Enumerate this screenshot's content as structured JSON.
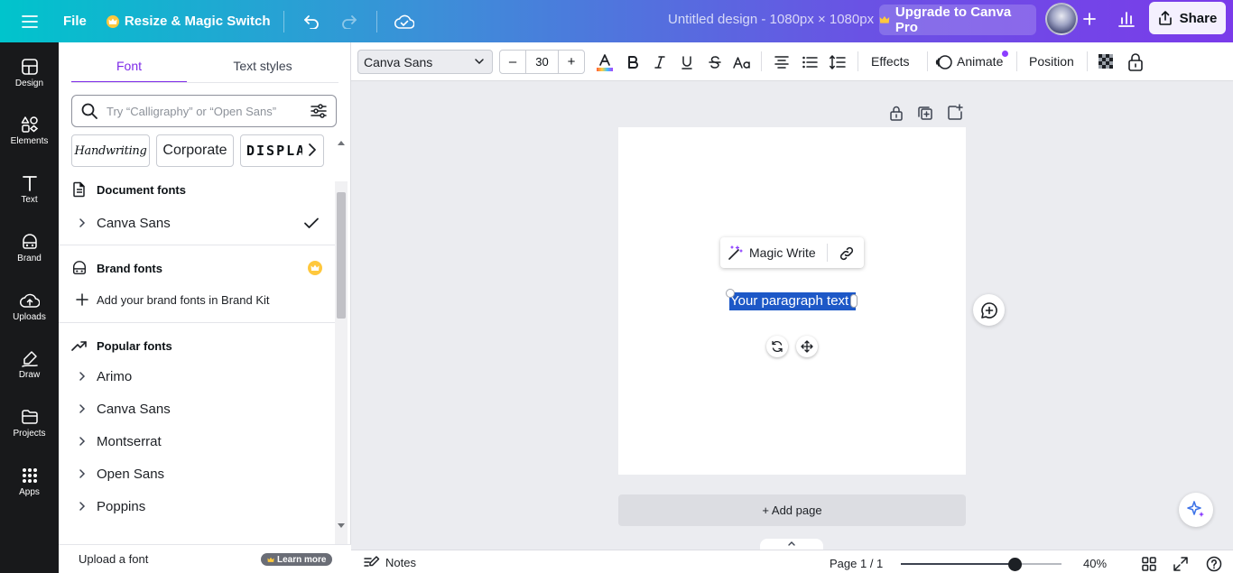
{
  "topbar": {
    "file_label": "File",
    "magic_label": "Resize & Magic Switch",
    "design_title": "Untitled design - 1080px × 1080px",
    "upgrade_label": "Upgrade to Canva Pro",
    "share_label": "Share"
  },
  "rail": {
    "items": [
      {
        "label": "Design",
        "icon": "design-icon"
      },
      {
        "label": "Elements",
        "icon": "elements-icon"
      },
      {
        "label": "Text",
        "icon": "text-icon"
      },
      {
        "label": "Brand",
        "icon": "brand-icon"
      },
      {
        "label": "Uploads",
        "icon": "uploads-icon"
      },
      {
        "label": "Draw",
        "icon": "draw-icon"
      },
      {
        "label": "Projects",
        "icon": "projects-icon"
      },
      {
        "label": "Apps",
        "icon": "apps-icon"
      }
    ]
  },
  "panel": {
    "tabs": [
      {
        "label": "Font",
        "active": true
      },
      {
        "label": "Text styles",
        "active": false
      }
    ],
    "search_placeholder": "Try “Calligraphy” or “Open Sans”",
    "chips": [
      "Handwriting",
      "Corporate",
      "DISPLAY"
    ],
    "document_fonts_title": "Document fonts",
    "document_fonts": [
      "Canva Sans"
    ],
    "brand_fonts_title": "Brand fonts",
    "brand_fonts_cta": "Add your brand fonts in Brand Kit",
    "popular_fonts_title": "Popular fonts",
    "popular_fonts": [
      "Arimo",
      "Canva Sans",
      "Montserrat",
      "Open Sans",
      "Poppins"
    ],
    "upload_font_label": "Upload a font",
    "learn_more_label": "Learn more"
  },
  "toolbar": {
    "font_family": "Canva Sans",
    "font_size": "30",
    "decrease_label": "–",
    "increase_label": "+",
    "effects_label": "Effects",
    "animate_label": "Animate",
    "position_label": "Position",
    "text_color": "#7d2ae8"
  },
  "canvas": {
    "magic_write_label": "Magic Write",
    "text_content": "Your paragraph text",
    "add_page_label": "+ Add page"
  },
  "footer": {
    "notes_label": "Notes",
    "page_indicator": "Page 1 / 1",
    "zoom_value": "40%",
    "zoom_fraction": 0.4
  },
  "colors": {
    "accent": "#7d2ae8",
    "selection": "#1d58c7",
    "premium": "#ffc83d"
  }
}
